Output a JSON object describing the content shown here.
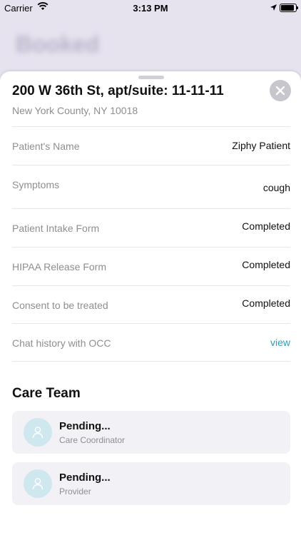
{
  "status_bar": {
    "carrier": "Carrier",
    "time": "3:13 PM"
  },
  "background": {
    "title": "Booked"
  },
  "sheet": {
    "address_line1": "200 W 36th St, apt/suite: 11-11-11",
    "address_line2": "New York County, NY 10018",
    "rows": [
      {
        "label": "Patient's Name",
        "value": "Ziphy Patient"
      },
      {
        "label": "Symptoms",
        "value": "cough"
      },
      {
        "label": "Patient Intake Form",
        "value": "Completed"
      },
      {
        "label": "HIPAA Release Form",
        "value": "Completed"
      },
      {
        "label": "Consent to be treated",
        "value": "Completed"
      },
      {
        "label": "Chat history with OCC",
        "value": "view"
      }
    ],
    "care_team": {
      "title": "Care Team",
      "members": [
        {
          "name": "Pending...",
          "role": "Care Coordinator"
        },
        {
          "name": "Pending...",
          "role": "Provider"
        }
      ]
    }
  },
  "colors": {
    "link": "#2aa0b6",
    "avatar_bg": "#cfe7ee",
    "card_bg": "#f2f1f6"
  },
  "icons": [
    "wifi-icon",
    "location-arrow-icon",
    "battery-icon",
    "close-icon",
    "person-icon"
  ]
}
